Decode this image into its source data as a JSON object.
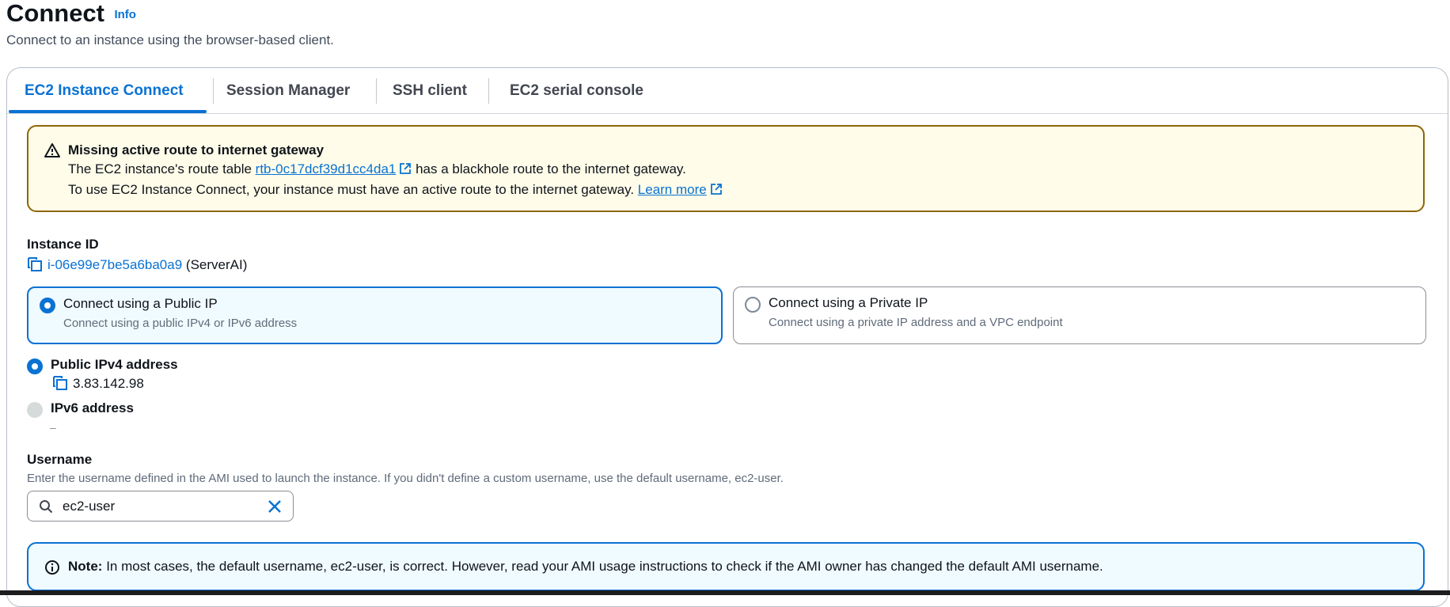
{
  "page": {
    "title": "Connect",
    "info_link": "Info",
    "subtitle": "Connect to an instance using the browser-based client."
  },
  "tabs": [
    {
      "label": "EC2 Instance Connect",
      "active": true
    },
    {
      "label": "Session Manager",
      "active": false
    },
    {
      "label": "SSH client",
      "active": false
    },
    {
      "label": "EC2 serial console",
      "active": false
    }
  ],
  "warning": {
    "title": "Missing active route to internet gateway",
    "line1_prefix": "The EC2 instance's route table",
    "route_table_link": "rtb-0c17dcf39d1cc4da1",
    "line1_suffix": "has a blackhole route to the internet gateway.",
    "line2_text": "To use EC2 Instance Connect, your instance must have an active route to the internet gateway.",
    "learn_more": "Learn more",
    "icon": "warning-triangle-icon",
    "color": "#8d6605"
  },
  "instance": {
    "label": "Instance ID",
    "id": "i-06e99e7be5a6ba0a9",
    "name": "(ServerAI)"
  },
  "connection_type": {
    "public": {
      "title": "Connect using a Public IP",
      "desc": "Connect using a public IPv4 or IPv6 address",
      "selected": true
    },
    "private": {
      "title": "Connect using a Private IP",
      "desc": "Connect using a private IP address and a VPC endpoint",
      "selected": false
    }
  },
  "ip_options": {
    "ipv4": {
      "label": "Public IPv4 address",
      "value": "3.83.142.98",
      "selected": true
    },
    "ipv6": {
      "label": "IPv6 address",
      "value": "–",
      "disabled": true
    }
  },
  "username": {
    "label": "Username",
    "description": "Enter the username defined in the AMI used to launch the instance. If you didn't define a custom username, use the default username, ec2-user.",
    "value": "ec2-user"
  },
  "note": {
    "label": "Note:",
    "text": "In most cases, the default username, ec2-user, is correct. However, read your AMI usage instructions to check if the AMI owner has changed the default AMI username.",
    "icon": "info-circle-icon"
  },
  "colors": {
    "accent": "#0972d3",
    "warning_bg": "#fffce9",
    "info_bg": "#f0fbff"
  }
}
